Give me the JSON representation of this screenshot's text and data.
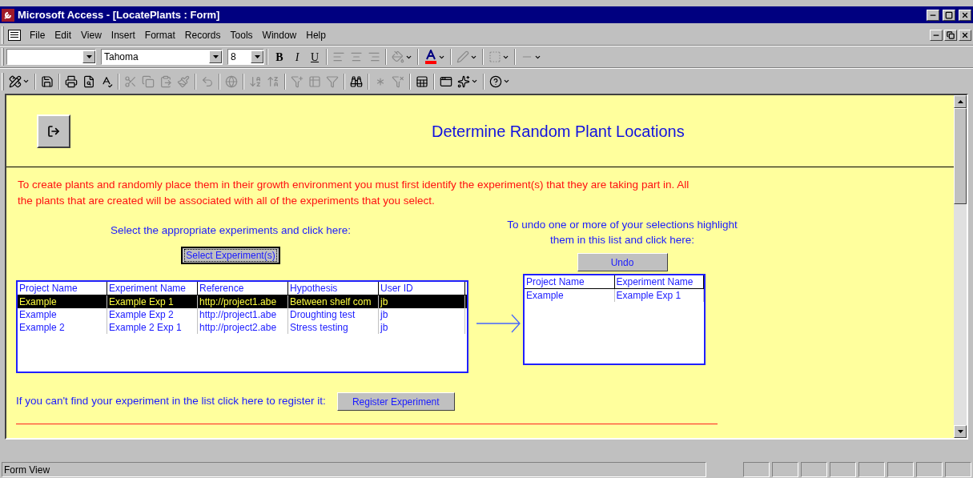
{
  "window": {
    "title": "Microsoft Access - [LocatePlants : Form]"
  },
  "menu": [
    "File",
    "Edit",
    "View",
    "Insert",
    "Format",
    "Records",
    "Tools",
    "Window",
    "Help"
  ],
  "formatting_toolbar": {
    "font": "Tahoma",
    "size": "8",
    "style_buttons": [
      "B",
      "I",
      "U"
    ]
  },
  "form": {
    "title": "Determine Random Plant Locations",
    "intro": "To create plants and randomly place them in their growth environment you must first identify the experiment(s) that they are taking part in. All the plants that are created will be associated with all of the experiments that you select.",
    "select_prompt": "Select the appropriate experiments and click here:",
    "select_button": "Select Experiment(s)",
    "undo_prompt": "To undo one or more of your selections highlight them in this list and click here:",
    "undo_button": "Undo",
    "experiments": {
      "columns": [
        "Project Name",
        "Experiment Name",
        "Reference",
        "Hypothesis",
        "User ID"
      ],
      "rows": [
        {
          "cells": [
            "Example",
            "Example Exp 1",
            "http://project1.abe",
            "Between shelf com",
            "jb"
          ],
          "selected": true
        },
        {
          "cells": [
            "Example",
            "Example Exp 2",
            "http://project1.abe",
            "Droughting test",
            "jb"
          ],
          "selected": false
        },
        {
          "cells": [
            "Example 2",
            "Example 2 Exp 1",
            "http://project2.abe",
            "Stress testing",
            "jb"
          ],
          "selected": false
        }
      ]
    },
    "selected_list": {
      "columns": [
        "Project Name",
        "Experiment Name"
      ],
      "rows": [
        {
          "cells": [
            "Example",
            "Example Exp 1"
          ],
          "selected": false
        }
      ]
    },
    "register_prompt": "If you can't find your experiment in the list click here to register it:",
    "register_button": "Register Experiment"
  },
  "status_bar": {
    "text": "Form View"
  }
}
